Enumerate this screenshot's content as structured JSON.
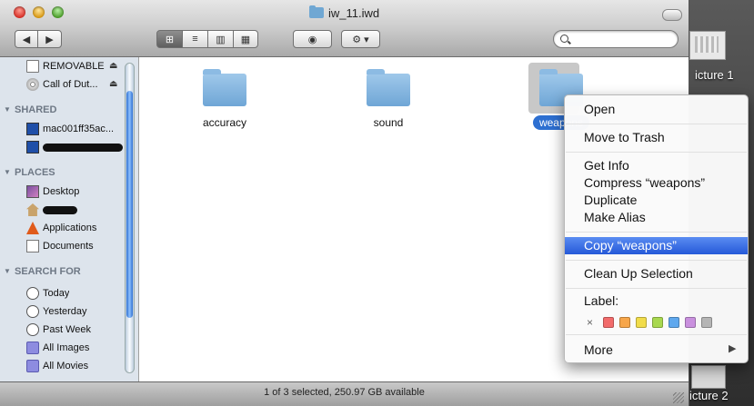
{
  "window": {
    "title": "iw_11.iwd"
  },
  "toolbar": {
    "back_symbol": "◀",
    "forward_symbol": "▶",
    "quicklook_symbol": "◉",
    "action_symbol": "⚙ ▾",
    "view_icons": [
      "⊞",
      "≡",
      "▥",
      "▦"
    ],
    "search_placeholder": ""
  },
  "sidebar": {
    "devices": [
      {
        "label": "REMOVABLE",
        "icon": "drive-icon",
        "eject": "⏏"
      },
      {
        "label": "Call of Dut...",
        "icon": "cd-icon",
        "eject": "⏏"
      }
    ],
    "shared_heading": "SHARED",
    "shared": [
      {
        "label": "mac001ff35ac...",
        "icon": "computer-icon"
      }
    ],
    "places_heading": "PLACES",
    "places": [
      {
        "label": "Desktop",
        "icon": "desktop-icon"
      },
      {
        "label": "Applications",
        "icon": "applications-icon"
      },
      {
        "label": "Documents",
        "icon": "documents-icon"
      }
    ],
    "search_heading": "SEARCH FOR",
    "search": [
      {
        "label": "Today",
        "icon": "clock-icon"
      },
      {
        "label": "Yesterday",
        "icon": "clock-icon"
      },
      {
        "label": "Past Week",
        "icon": "clock-icon"
      },
      {
        "label": "All Images",
        "icon": "smart-folder-icon"
      },
      {
        "label": "All Movies",
        "icon": "smart-folder-icon"
      }
    ]
  },
  "files": [
    {
      "name": "accuracy",
      "selected": false
    },
    {
      "name": "sound",
      "selected": false
    },
    {
      "name": "weapons",
      "selected": true
    }
  ],
  "status": {
    "text": "1 of 3 selected, 250.97 GB available"
  },
  "context_menu": {
    "items": [
      "Open",
      "Move to Trash",
      "Get Info",
      "Compress “weapons”",
      "Duplicate",
      "Make Alias",
      "Copy “weapons”",
      "Clean Up Selection",
      "More"
    ],
    "highlighted": "Copy “weapons”",
    "label_heading": "Label:",
    "label_none": "×",
    "label_colors": [
      "#f26b6b",
      "#f7a64a",
      "#f1dc4a",
      "#a8d84f",
      "#5fa8ee",
      "#c990de",
      "#b5b5b5"
    ]
  },
  "desktop": {
    "label_top": "icture 1",
    "label_bottom": "icture 2"
  }
}
